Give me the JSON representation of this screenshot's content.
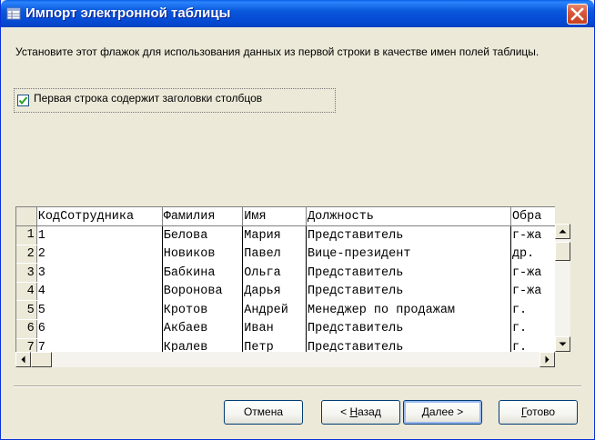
{
  "window": {
    "title": "Импорт электронной таблицы",
    "instruction": "Установите этот флажок для использования данных из первой строки в качестве имен полей таблицы.",
    "checkbox": {
      "label": "Первая строка содержит заголовки столбцов",
      "checked": true
    }
  },
  "grid": {
    "columns": [
      "КодСотрудника",
      "Фамилия",
      "Имя",
      "Должность",
      "Обра"
    ],
    "rows": [
      {
        "num": "1",
        "cells": [
          "1",
          "Белова",
          "Мария",
          "Представитель",
          "г-жа"
        ]
      },
      {
        "num": "2",
        "cells": [
          "2",
          "Новиков",
          "Павел",
          "Вице-президент",
          "др."
        ]
      },
      {
        "num": "3",
        "cells": [
          "3",
          "Бабкина",
          "Ольга",
          "Представитель",
          "г-жа"
        ]
      },
      {
        "num": "4",
        "cells": [
          "4",
          "Воронова",
          "Дарья",
          "Представитель",
          "г-жа"
        ]
      },
      {
        "num": "5",
        "cells": [
          "5",
          "Кротов",
          "Андрей",
          "Менеджер по продажам",
          "г."
        ]
      },
      {
        "num": "6",
        "cells": [
          "6",
          "Акбаев",
          "Иван",
          "Представитель",
          "г."
        ]
      },
      {
        "num": "7",
        "cells": [
          "7",
          "Кралев",
          "Петр",
          "Представитель",
          "г."
        ]
      }
    ]
  },
  "buttons": {
    "cancel": "Отмена",
    "back_prefix": "< ",
    "back_key": "Н",
    "back_rest": "азад",
    "next_key": "Д",
    "next_rest": "алее >",
    "finish_key": "Г",
    "finish_rest": "отово"
  },
  "colors": {
    "title_bar": "#0a58dc",
    "close_button": "#d9583a",
    "check_mark": "#21a121",
    "dialog_face": "#ece9d8"
  }
}
